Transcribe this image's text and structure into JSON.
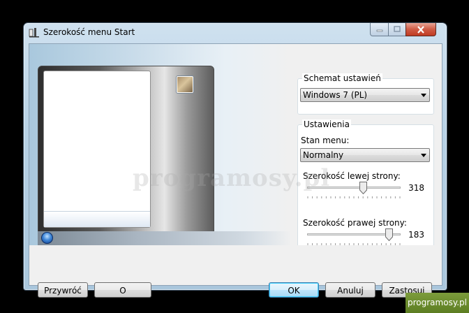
{
  "window": {
    "title": "Szerokość menu Start"
  },
  "preview": {
    "watermark": "programosy.pl"
  },
  "schema": {
    "legend": "Schemat ustawień",
    "selected": "Windows 7 (PL)"
  },
  "settings": {
    "legend": "Ustawienia",
    "menu_state_label": "Stan menu:",
    "menu_state_value": "Normalny",
    "left_width_label": "Szerokość lewej strony:",
    "left_width_value": "318",
    "left_width_level": 0.6,
    "right_width_label": "Szerokość prawej strony:",
    "right_width_value": "183",
    "right_width_level": 0.88
  },
  "buttons": {
    "restore": "Przywróć",
    "about": "O programie",
    "ok": "OK",
    "cancel": "Anuluj",
    "apply": "Zastosuj"
  },
  "badge": {
    "site": "programosy.pl"
  },
  "icons": {
    "app": "computer-icon",
    "avatar": "user-picture-icon",
    "orb": "start-orb-icon"
  }
}
